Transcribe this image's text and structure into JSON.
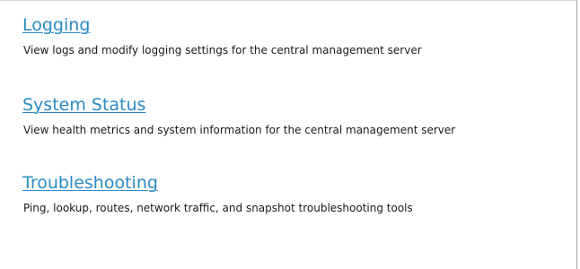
{
  "sections": [
    {
      "title": "Logging",
      "description": "View logs and modify logging settings for the central management server"
    },
    {
      "title": "System Status",
      "description": "View health metrics and system information for the central management server"
    },
    {
      "title": "Troubleshooting",
      "description": "Ping, lookup, routes, network traffic, and snapshot troubleshooting tools"
    }
  ],
  "colors": {
    "link": "#2a8ac2",
    "text": "#1a1a1a",
    "border": "#a0a0a0"
  }
}
